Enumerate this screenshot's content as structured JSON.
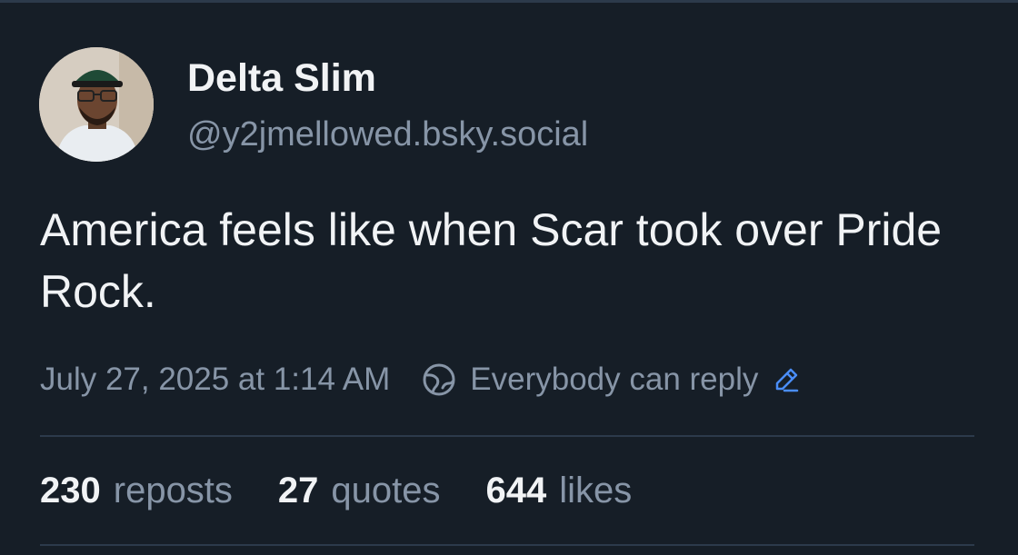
{
  "post": {
    "author": {
      "display_name": "Delta Slim",
      "handle": "@y2jmellowed.bsky.social"
    },
    "text": "America feels like when Scar took over Pride Rock.",
    "timestamp": "July 27, 2025 at 1:14 AM",
    "reply_setting": "Everybody can reply",
    "stats": {
      "reposts": {
        "count": "230",
        "label": "reposts"
      },
      "quotes": {
        "count": "27",
        "label": "quotes"
      },
      "likes": {
        "count": "644",
        "label": "likes"
      }
    }
  },
  "icons": {
    "globe": "globe-icon",
    "edit": "pencil-icon"
  },
  "colors": {
    "background": "#161e27",
    "text_primary": "#f1f3f5",
    "text_secondary": "#8795a7",
    "accent": "#4a8df7",
    "divider": "#2c3a4b"
  }
}
